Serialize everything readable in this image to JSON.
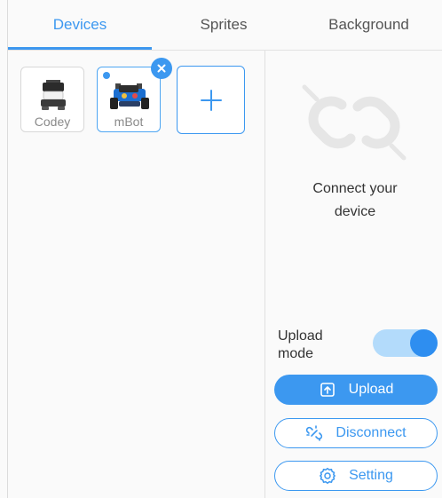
{
  "tabs": [
    {
      "label": "Devices"
    },
    {
      "label": "Sprites"
    },
    {
      "label": "Background"
    }
  ],
  "devices": [
    {
      "name": "Codey"
    },
    {
      "name": "mBot",
      "selected": true
    }
  ],
  "add_device": {
    "icon": "plus-icon"
  },
  "status": {
    "line1": "Connect your",
    "line2": "device",
    "icon": "disconnected-link-icon"
  },
  "upload_mode": {
    "line1": "Upload",
    "line2": "mode",
    "enabled": true
  },
  "buttons": {
    "upload": "Upload",
    "disconnect": "Disconnect",
    "setting": "Setting"
  },
  "colors": {
    "accent": "#3c98f0",
    "toggle_track": "#b3dbfb"
  }
}
